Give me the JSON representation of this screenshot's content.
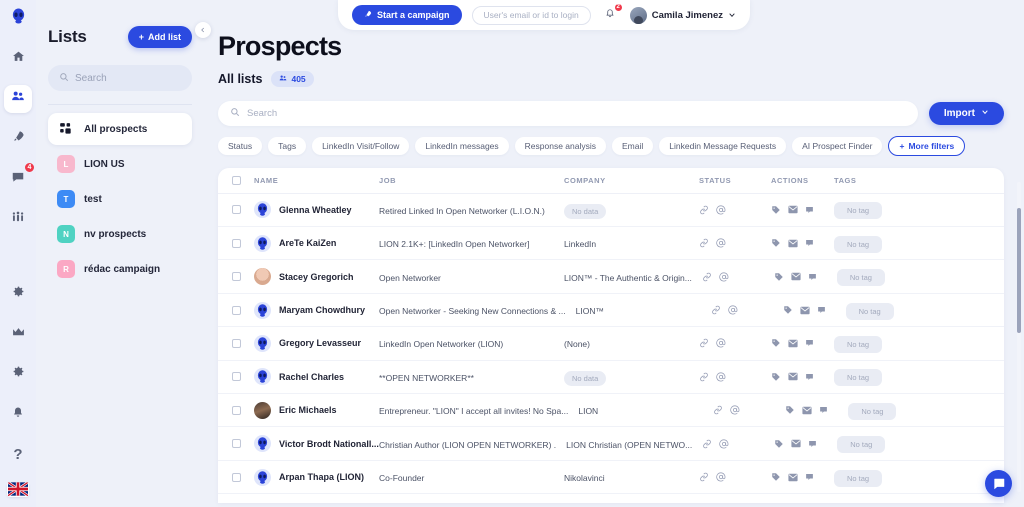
{
  "colors": {
    "accent": "#2b4ae0",
    "badge_red": "#f0394b",
    "page_bg": "#eef1f9",
    "muted": "#a3aabd"
  },
  "rail": {
    "logo": "alien-logo",
    "items": [
      {
        "icon": "home-icon",
        "name": "home",
        "active": false,
        "badge": ""
      },
      {
        "icon": "people-icon",
        "name": "prospects",
        "active": true,
        "badge": ""
      },
      {
        "icon": "rocket-icon",
        "name": "campaigns",
        "active": false,
        "badge": ""
      },
      {
        "icon": "chat-icon",
        "name": "messages",
        "active": false,
        "badge": "4"
      },
      {
        "icon": "team-icon",
        "name": "team",
        "active": false,
        "badge": ""
      },
      {
        "icon": "gear-icon",
        "name": "settings-top",
        "active": false,
        "badge": ""
      }
    ],
    "bottom_items": [
      {
        "icon": "crown-icon",
        "name": "upgrade"
      },
      {
        "icon": "gear-icon",
        "name": "settings"
      },
      {
        "icon": "bell-icon",
        "name": "notifications"
      },
      {
        "icon": "help-icon",
        "name": "help"
      }
    ],
    "flag": "uk-flag-icon"
  },
  "topbar": {
    "campaign_button": "Start a campaign",
    "campaign_icon": "rocket-icon",
    "login_placeholder": "User's email or id to login",
    "bell_icon": "bell-icon",
    "bell_badge": "2",
    "user_name": "Camila Jimenez",
    "chevron": "chevron-down-icon"
  },
  "lists_panel": {
    "title": "Lists",
    "add_button": "Add list",
    "search_placeholder": "Search",
    "items": [
      {
        "label": "All prospects",
        "avatar_letter": "",
        "avatar_color": "",
        "icon": "grid-icon",
        "active": true
      },
      {
        "label": "LION US",
        "avatar_letter": "L",
        "avatar_color": "#f8b8cd",
        "icon": "",
        "active": false
      },
      {
        "label": "test",
        "avatar_letter": "T",
        "avatar_color": "#3d8bf5",
        "icon": "",
        "active": false
      },
      {
        "label": "nv prospects",
        "avatar_letter": "N",
        "avatar_color": "#4fd2c2",
        "icon": "",
        "active": false
      },
      {
        "label": "rédac campaign",
        "avatar_letter": "R",
        "avatar_color": "#fba8c4",
        "icon": "",
        "active": false
      }
    ]
  },
  "collapse_icon": "chevron-left-icon",
  "main": {
    "title": "Prospects",
    "breadcrumb": "All lists",
    "count_badge": "405",
    "count_icon": "people-icon",
    "search_placeholder": "Search",
    "search_icon": "search-icon",
    "import_button": "Import",
    "import_chevron": "chevron-down-icon",
    "filters": [
      "Status",
      "Tags",
      "LinkedIn Visit/Follow",
      "LinkedIn messages",
      "Response analysis",
      "Email",
      "Linkedin Message Requests",
      "AI Prospect Finder"
    ],
    "more_filters": "More filters"
  },
  "table": {
    "columns": [
      "NAME",
      "JOB",
      "COMPANY",
      "STATUS",
      "ACTIONS",
      "TAGS"
    ],
    "no_data_label": "No data",
    "no_tag_label": "No tag",
    "status_icons": [
      "link-icon",
      "at-icon"
    ],
    "action_icons": [
      "tag-icon",
      "envelope-icon",
      "comment-icon"
    ],
    "rows": [
      {
        "name": "Glenna Wheatley",
        "avatar": "alien",
        "job": "Retired Linked In Open Networker (L.I.O.N.)",
        "company": "",
        "company_empty": true,
        "tag": ""
      },
      {
        "name": "AreTe KaiZen",
        "avatar": "alien",
        "job": "LION 2.1K+: [LinkedIn Open Networker]",
        "company": "LinkedIn",
        "company_empty": false,
        "tag": ""
      },
      {
        "name": "Stacey Gregorich",
        "avatar": "photo-a",
        "job": "Open Networker",
        "company": "LION™ - The Authentic & Origin...",
        "company_empty": false,
        "tag": ""
      },
      {
        "name": "Maryam Chowdhury",
        "avatar": "alien",
        "job": "Open Networker - Seeking New Connections & ...",
        "company": "LION™",
        "company_empty": false,
        "tag": ""
      },
      {
        "name": "Gregory Levasseur",
        "avatar": "alien",
        "job": "LinkedIn Open Networker (LION)",
        "company": "(None)",
        "company_empty": false,
        "tag": ""
      },
      {
        "name": "Rachel Charles",
        "avatar": "alien",
        "job": "**OPEN NETWORKER**",
        "company": "",
        "company_empty": true,
        "tag": ""
      },
      {
        "name": "Eric Michaels",
        "avatar": "photo-b",
        "job": "Entrepreneur. \"LION\" I accept all invites! No Spa...",
        "company": "LION",
        "company_empty": false,
        "tag": ""
      },
      {
        "name": "Victor Brodt Nationall...",
        "avatar": "alien",
        "job": "Christian Author (LION OPEN NETWORKER) .",
        "company": "LION Christian (OPEN NETWO...",
        "company_empty": false,
        "tag": ""
      },
      {
        "name": "Arpan Thapa (LION)",
        "avatar": "alien",
        "job": "Co-Founder",
        "company": "Nikolavinci",
        "company_empty": false,
        "tag": ""
      }
    ]
  },
  "chat_widget": {
    "icon": "messenger-icon"
  }
}
